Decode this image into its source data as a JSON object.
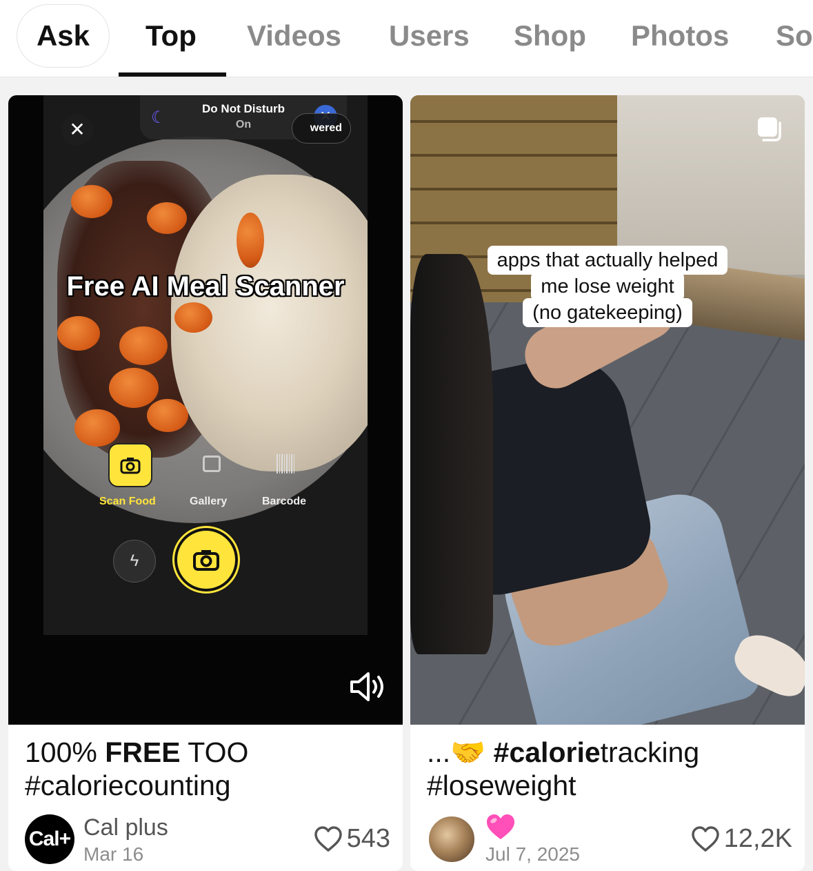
{
  "tabs": {
    "ask_label": "Ask",
    "items": [
      {
        "label": "Top"
      },
      {
        "label": "Videos"
      },
      {
        "label": "Users"
      },
      {
        "label": "Shop"
      },
      {
        "label": "Photos"
      },
      {
        "label": "So"
      }
    ],
    "active": "Top"
  },
  "cards": [
    {
      "overlay": {
        "dnd_title": "Do Not Disturb",
        "dnd_status": "On",
        "powered_partial": "wered",
        "headline": "Free AI Meal Scanner",
        "modes": [
          "Scan Food",
          "Gallery",
          "Barcode"
        ],
        "icons": [
          "close-icon",
          "moon-icon",
          "camera-icon",
          "gallery-icon",
          "barcode-icon",
          "flash-off-icon",
          "shutter-icon",
          "sound-on-icon"
        ]
      },
      "caption_parts": [
        "100% ",
        "FREE",
        " TOO",
        "#caloriecounting"
      ],
      "author": {
        "avatar_text": "Cal+",
        "name": "Cal plus",
        "date": "Mar 16"
      },
      "likes": "543"
    },
    {
      "overlay": {
        "caption_lines": [
          "apps that actually helped",
          "me lose weight",
          "(no gatekeeping)"
        ],
        "icons": [
          "multi-photo-icon"
        ]
      },
      "caption_parts": [
        "...",
        "🤝 ",
        "#calorie",
        "tracking",
        "#loseweight"
      ],
      "author": {
        "name_emoji": "heart-emoji",
        "date": "Jul 7, 2025"
      },
      "likes": "12,2K"
    }
  ],
  "colors": {
    "accent_yellow": "#ffe53b",
    "active_tab": "#111111",
    "inactive_tab": "#8a8a8a"
  }
}
